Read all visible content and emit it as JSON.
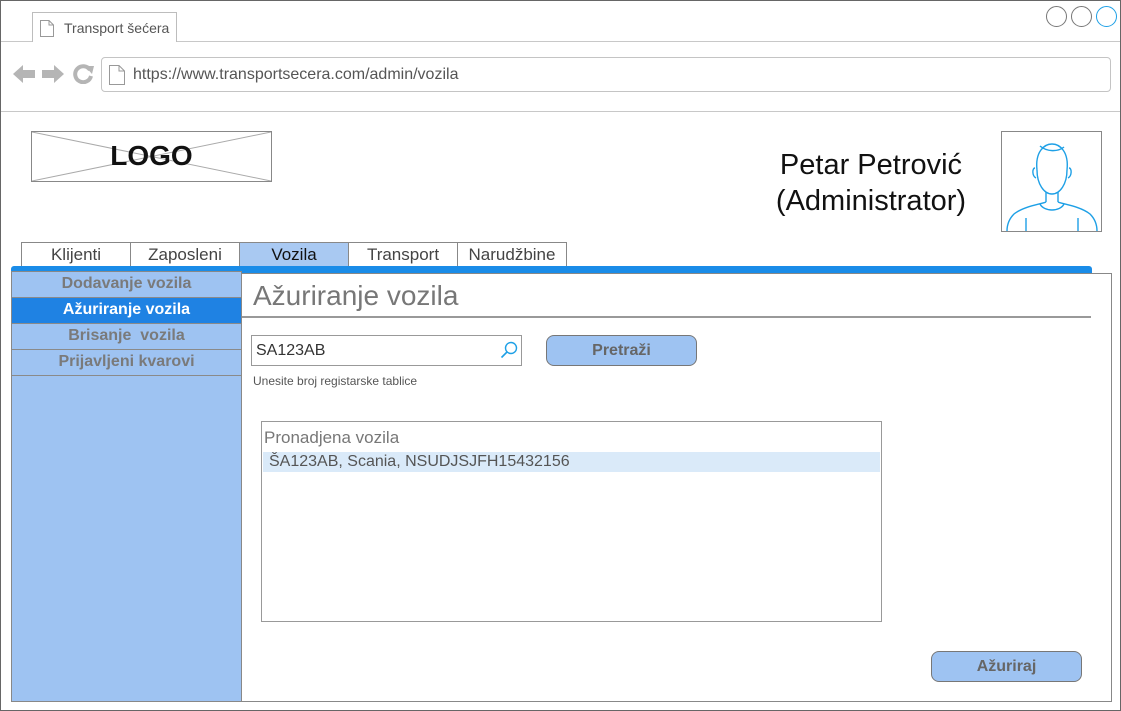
{
  "browser": {
    "tab_title": "Transport šećera",
    "url": "https://www.transportsecera.com/admin/vozila"
  },
  "header": {
    "logo_text": "LOGO",
    "user_name": "Petar Petrović",
    "user_role": "(Administrator)"
  },
  "menu": {
    "items": [
      {
        "label": "Klijenti"
      },
      {
        "label": "Zaposleni"
      },
      {
        "label": "Vozila"
      },
      {
        "label": "Transport"
      },
      {
        "label": "Narudžbine"
      }
    ],
    "active": "Vozila"
  },
  "sidebar": {
    "items": [
      {
        "label": "Dodavanje vozila"
      },
      {
        "label": "Ažuriranje vozila"
      },
      {
        "label": "Brisanje  vozila"
      },
      {
        "label": "Prijavljeni kvarovi"
      }
    ],
    "active": "Ažuriranje vozila"
  },
  "main": {
    "title": "Ažuriranje vozila",
    "search_value": "SA123AB",
    "search_hint": "Unesite broj registarske tablice",
    "search_button": "Pretraži",
    "results_title": "Pronadjena vozila",
    "results": [
      "ŠA123AB, Scania, NSUDJSJFH15432156"
    ],
    "update_button": "Ažuriraj"
  },
  "colors": {
    "accent": "#1a8ce8",
    "active_sidebar": "#1f82e3",
    "sidebar_bg": "#9ec3f2",
    "button_bg": "#9ec3f2",
    "selected_row": "#daeaf9"
  }
}
